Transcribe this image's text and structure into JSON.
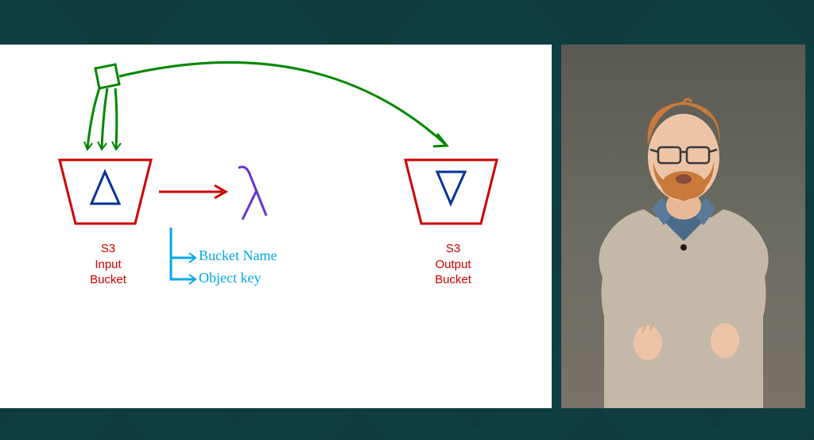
{
  "diagram": {
    "inputBucket": {
      "label_line1": "S3",
      "label_line2": "Input",
      "label_line3": "Bucket",
      "symbol": "triangle-up"
    },
    "outputBucket": {
      "label_line1": "S3",
      "label_line2": "Output",
      "label_line3": "Bucket",
      "symbol": "triangle-down"
    },
    "lambda": {
      "symbol": "lambda"
    },
    "annotations": {
      "bucketName": "Bucket Name",
      "objectKey": "Object key"
    },
    "colors": {
      "bucket": "#cc0000",
      "arrow_red": "#cc0000",
      "arrow_green": "#008800",
      "lambda": "#6633cc",
      "symbol_blue": "#003399",
      "annotation": "#00a8e8"
    }
  }
}
